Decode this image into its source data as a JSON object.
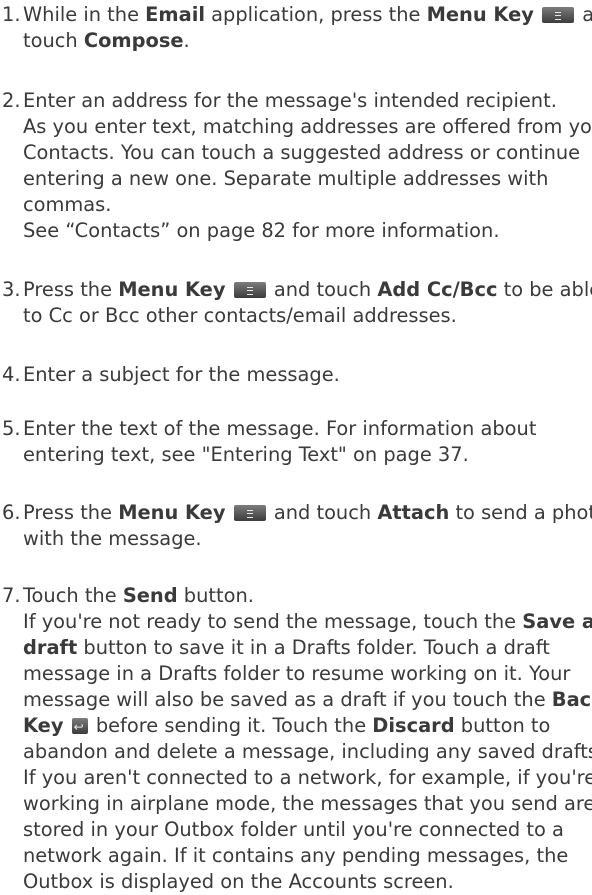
{
  "steps": [
    {
      "number": "1.",
      "lines": [
        [
          {
            "t": "While in the "
          },
          {
            "t": "Email",
            "b": true
          },
          {
            "t": " application, press the "
          },
          {
            "t": "Menu Key",
            "b": true
          },
          {
            "t": " "
          },
          {
            "icon": "menu-key-icon"
          },
          {
            "t": " and"
          }
        ],
        [
          {
            "t": "touch "
          },
          {
            "t": "Compose",
            "b": true
          },
          {
            "t": "."
          }
        ]
      ]
    },
    {
      "number": "2.",
      "lines": [
        [
          {
            "t": "Enter an address for the message's intended recipient."
          }
        ],
        [
          {
            "t": "As you enter text, matching addresses are offered from your"
          }
        ],
        [
          {
            "t": "Contacts. You can touch a suggested address or continue"
          }
        ],
        [
          {
            "t": "entering a new one. Separate multiple addresses with"
          }
        ],
        [
          {
            "t": "commas."
          }
        ],
        [
          {
            "t": "See “Contacts” on page 82 for more information."
          }
        ]
      ]
    },
    {
      "number": "3.",
      "lines": [
        [
          {
            "t": "Press the "
          },
          {
            "t": "Menu Key",
            "b": true
          },
          {
            "t": " "
          },
          {
            "icon": "menu-key-icon"
          },
          {
            "t": " and touch "
          },
          {
            "t": "Add Cc/Bcc",
            "b": true
          },
          {
            "t": " to be able"
          }
        ],
        [
          {
            "t": "to Cc or Bcc other contacts/email addresses."
          }
        ]
      ]
    },
    {
      "number": "4.",
      "lines": [
        [
          {
            "t": "Enter a subject for the message."
          }
        ]
      ]
    },
    {
      "number": "5.",
      "lines": [
        [
          {
            "t": "Enter the text of the message. For information about"
          }
        ],
        [
          {
            "t": "entering text, see \"Entering Text\" on page 37."
          }
        ]
      ]
    },
    {
      "number": "6.",
      "lines": [
        [
          {
            "t": "Press the "
          },
          {
            "t": "Menu Key",
            "b": true
          },
          {
            "t": " "
          },
          {
            "icon": "menu-key-icon"
          },
          {
            "t": " and touch "
          },
          {
            "t": "Attach",
            "b": true
          },
          {
            "t": " to send a photo"
          }
        ],
        [
          {
            "t": "with the message."
          }
        ]
      ]
    },
    {
      "number": "7.",
      "lines": [
        [
          {
            "t": "Touch the "
          },
          {
            "t": "Send",
            "b": true
          },
          {
            "t": " button."
          }
        ],
        [
          {
            "t": "If you're not ready to send the message, touch the "
          },
          {
            "t": "Save as",
            "b": true
          }
        ],
        [
          {
            "t": "draft",
            "b": true
          },
          {
            "t": " button to save it in a Drafts folder. Touch a draft"
          }
        ],
        [
          {
            "t": "message in a Drafts folder to resume working on it. Your"
          }
        ],
        [
          {
            "t": "message will also be saved as a draft if you touch the "
          },
          {
            "t": "Back",
            "b": true
          }
        ],
        [
          {
            "t": "Key",
            "b": true
          },
          {
            "t": " "
          },
          {
            "icon": "back-key-icon"
          },
          {
            "t": " before sending it. Touch the "
          },
          {
            "t": "Discard",
            "b": true
          },
          {
            "t": " button to"
          }
        ],
        [
          {
            "t": "abandon and delete a message, including any saved drafts."
          }
        ],
        [
          {
            "t": "If you aren't connected to a network, for example, if you're"
          }
        ],
        [
          {
            "t": "working in airplane mode, the messages that you send are"
          }
        ],
        [
          {
            "t": "stored in your Outbox folder until you're connected to a"
          }
        ],
        [
          {
            "t": "network again. If it contains any pending messages, the"
          }
        ],
        [
          {
            "t": "Outbox is displayed on the Accounts screen."
          }
        ]
      ]
    }
  ]
}
